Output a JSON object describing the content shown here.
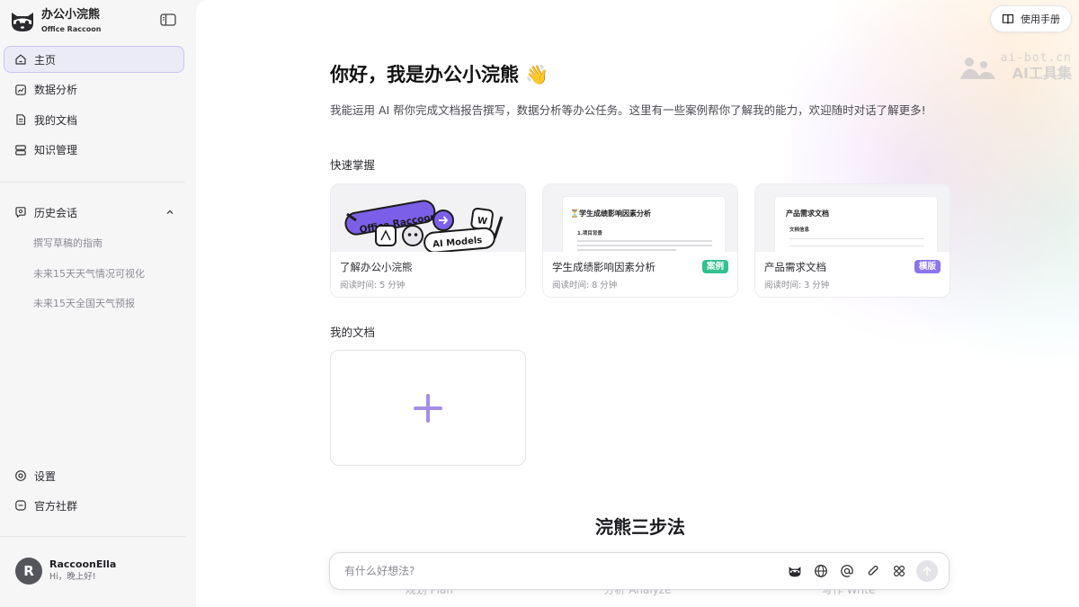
{
  "brand": {
    "title": "办公小浣熊",
    "subtitle": "Office Raccoon"
  },
  "nav": {
    "items": [
      {
        "label": "主页",
        "icon": "home-icon",
        "active": true
      },
      {
        "label": "数据分析",
        "icon": "chart-icon"
      },
      {
        "label": "我的文档",
        "icon": "document-icon"
      },
      {
        "label": "知识管理",
        "icon": "database-icon"
      }
    ]
  },
  "history": {
    "label": "历史会话",
    "icon": "chat-history-icon",
    "items": [
      "撰写草稿的指南",
      "未来15天天气情况可视化",
      "未来15天全国天气预报"
    ]
  },
  "bottom_nav": {
    "settings": "设置",
    "community": "官方社群"
  },
  "user": {
    "initial": "R",
    "name": "RaccoonElla",
    "greeting": "Hi，晚上好!"
  },
  "top": {
    "manual_label": "使用手册"
  },
  "watermark": {
    "line1": "ai-bot.cn",
    "line2": "AI工具集"
  },
  "main": {
    "greeting": "你好，我是办公小浣熊 👋",
    "intro": "我能运用 AI 帮你完成文档报告撰写，数据分析等办公任务。这里有一些案例帮你了解我的能力，欢迎随时对话了解更多!",
    "quick_title": "快速掌握",
    "cards": [
      {
        "title": "了解办公小浣熊",
        "time": "阅读时间: 5 分钟",
        "thumb_label_1": "Office Raccoon",
        "thumb_label_2": "AI Models"
      },
      {
        "title": "学生成绩影响因素分析",
        "time": "阅读时间: 8 分钟",
        "tag": "案例",
        "doc_title": "⏳学生成绩影响因素分析",
        "doc_sub": "1.项目背景"
      },
      {
        "title": "产品需求文档",
        "time": "阅读时间: 3 分钟",
        "tag": "模版",
        "doc_title": "产品需求文档",
        "doc_sub": "文档信息"
      }
    ],
    "my_docs_title": "我的文档",
    "steps_title": "浣熊三步法",
    "steps_ghost": [
      "规划 Plan",
      "分析 Analyze",
      "写作 Write"
    ]
  },
  "chat": {
    "placeholder": "有什么好想法?"
  }
}
